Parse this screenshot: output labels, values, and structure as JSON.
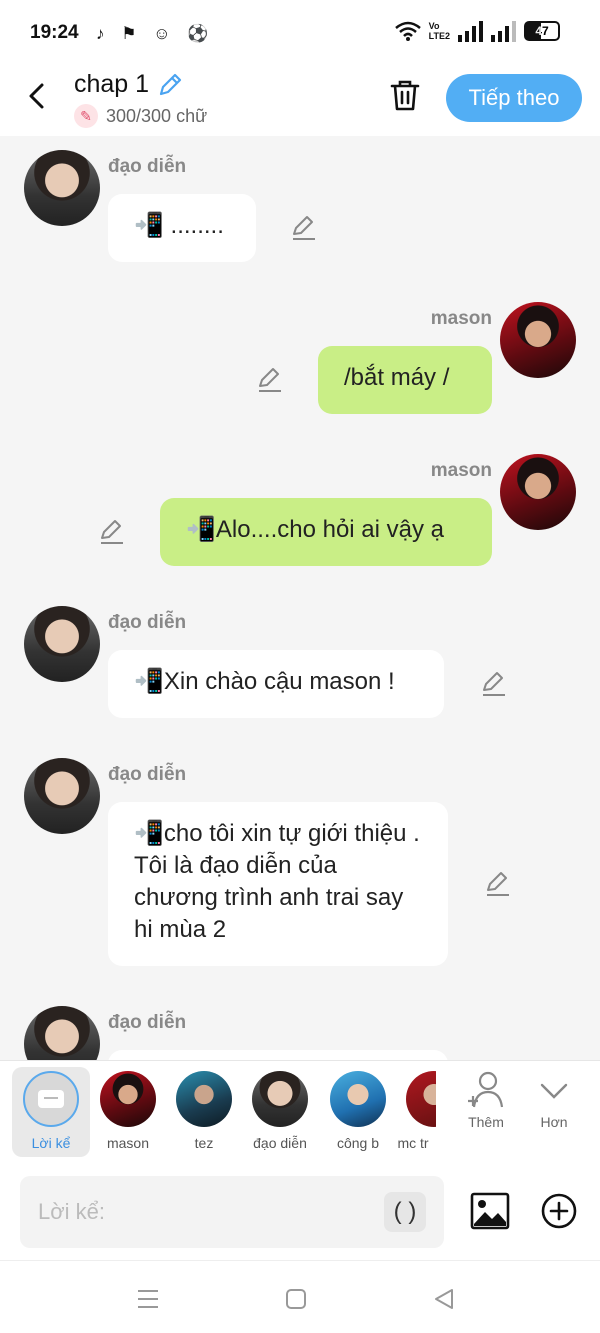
{
  "status_bar": {
    "time": "19:24",
    "battery": "47",
    "net_label_top": "Vo",
    "net_label_bottom": "LTE2"
  },
  "header": {
    "title": "chap 1",
    "word_count": "300/300 chữ",
    "next_label": "Tiếp theo"
  },
  "messages": [
    {
      "speaker": "đạo diễn",
      "text": "📲 ........",
      "side": "left"
    },
    {
      "speaker": "mason",
      "text": "/bắt máy /",
      "side": "right"
    },
    {
      "speaker": "mason",
      "text": "📲Alo....cho hỏi ai vậy ạ",
      "side": "right"
    },
    {
      "speaker": "đạo diễn",
      "text": "📲Xin chào cậu mason !",
      "side": "left"
    },
    {
      "speaker": "đạo diễn",
      "text": "📲cho tôi xin tự giới thiệu . Tôi là đạo diễn của chương trình anh trai say hi mùa 2",
      "side": "left"
    },
    {
      "speaker": "đạo diễn",
      "text": "",
      "side": "left"
    }
  ],
  "characters": [
    {
      "label": "Lời kể"
    },
    {
      "label": "mason"
    },
    {
      "label": "tez"
    },
    {
      "label": "đạo diễn"
    },
    {
      "label": "công b"
    },
    {
      "label": "mc tr"
    }
  ],
  "tools": {
    "add_label": "Thêm",
    "more_label": "Hơn"
  },
  "composer": {
    "placeholder": "Lời kể:",
    "paren_label": "( )"
  },
  "colors": {
    "accent": "#52aef4",
    "green_bubble": "#c9ee86"
  }
}
